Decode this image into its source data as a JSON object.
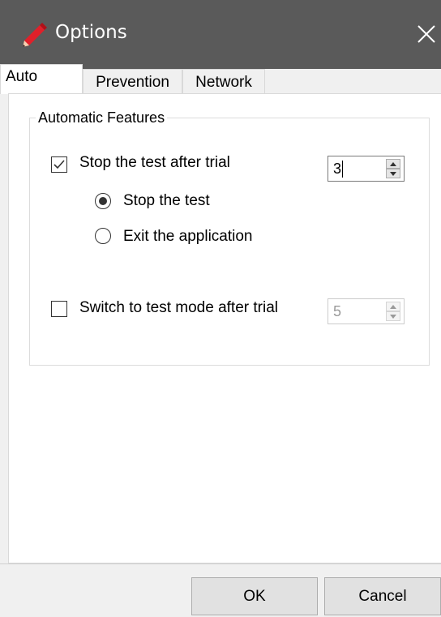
{
  "window": {
    "title": "Options"
  },
  "tabs": [
    {
      "label": "Auto",
      "active": true
    },
    {
      "label": "Prevention",
      "active": false
    },
    {
      "label": "Network",
      "active": false
    }
  ],
  "auto": {
    "group_title": "Automatic Features",
    "stop_trial": {
      "label": "Stop the test after trial",
      "checked": true,
      "value": "3"
    },
    "radios": [
      {
        "label": "Stop the test",
        "selected": true
      },
      {
        "label": "Exit the application",
        "selected": false
      }
    ],
    "switch_trial": {
      "label": "Switch to test mode after trial",
      "checked": false,
      "value": "5",
      "disabled": true
    }
  },
  "buttons": {
    "ok": "OK",
    "cancel": "Cancel"
  }
}
